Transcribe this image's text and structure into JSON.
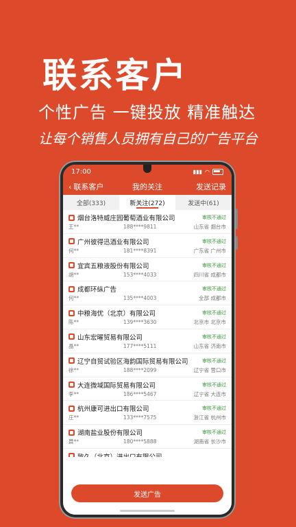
{
  "promo": {
    "title": "联系客户",
    "subtitle": "个性广告  一键投放  精准触达",
    "tagline": "让每个销售人员拥有自己的广告平台"
  },
  "status": {
    "time": "17:00"
  },
  "nav": {
    "back_label": "联系客户",
    "title": "我的关注",
    "right_label": "发送记录"
  },
  "tabs": [
    {
      "label": "全部(333)"
    },
    {
      "label": "新关注(272)"
    },
    {
      "label": "发送中(61)"
    }
  ],
  "rows": [
    {
      "company": "烟台洛特威庄园葡萄酒业有限公司",
      "audit": "审核不通过",
      "contact": "王**",
      "phone": "188****9811",
      "region": "山东省 烟台市"
    },
    {
      "company": "广州彼得迅酒业有限公司",
      "audit": "审核不通过",
      "contact": "何**",
      "phone": "181****8391",
      "region": "广东省 广州市"
    },
    {
      "company": "宜宾五粮液股份有限公司",
      "audit": "审核不通过",
      "contact": "胡**",
      "phone": "153****4033",
      "region": "四川省 成都市"
    },
    {
      "company": "成都环纵广告",
      "audit": "审核不通过",
      "contact": "何**",
      "phone": "135****4003",
      "region": "全部 成都市"
    },
    {
      "company": "中粮海优（北京）有限公司",
      "audit": "审核不通过",
      "contact": "陈**",
      "phone": "139****3630",
      "region": "北京市 北京市"
    },
    {
      "company": "山东宏曜贸易有限公司",
      "audit": "审核不通过",
      "contact": "晶**",
      "phone": "177****5111",
      "region": "山东省 济南市"
    },
    {
      "company": "辽宁自贸试验区海韵国际贸易有限公司",
      "audit": "审核不通过",
      "contact": "徐**",
      "phone": "188****2099",
      "region": "辽宁省 营口市"
    },
    {
      "company": "大连微域国际贸易有限公司",
      "audit": "审核不通过",
      "contact": "李**",
      "phone": "186****5467",
      "region": "辽宁省 大连市"
    },
    {
      "company": "杭州康可进出口有限公司",
      "audit": "审核不通过",
      "contact": "庄**",
      "phone": "133****7575",
      "region": "浙江省 杭州市"
    },
    {
      "company": "湖南盐业股份有限公司",
      "audit": "审核不通过",
      "contact": "聂**",
      "phone": "180****5888",
      "region": "湖南省 长沙市"
    },
    {
      "company": "致久（北京）进出口有限公司",
      "audit": "",
      "contact": "",
      "phone": "",
      "region": ""
    }
  ],
  "send_button": "发送广告"
}
